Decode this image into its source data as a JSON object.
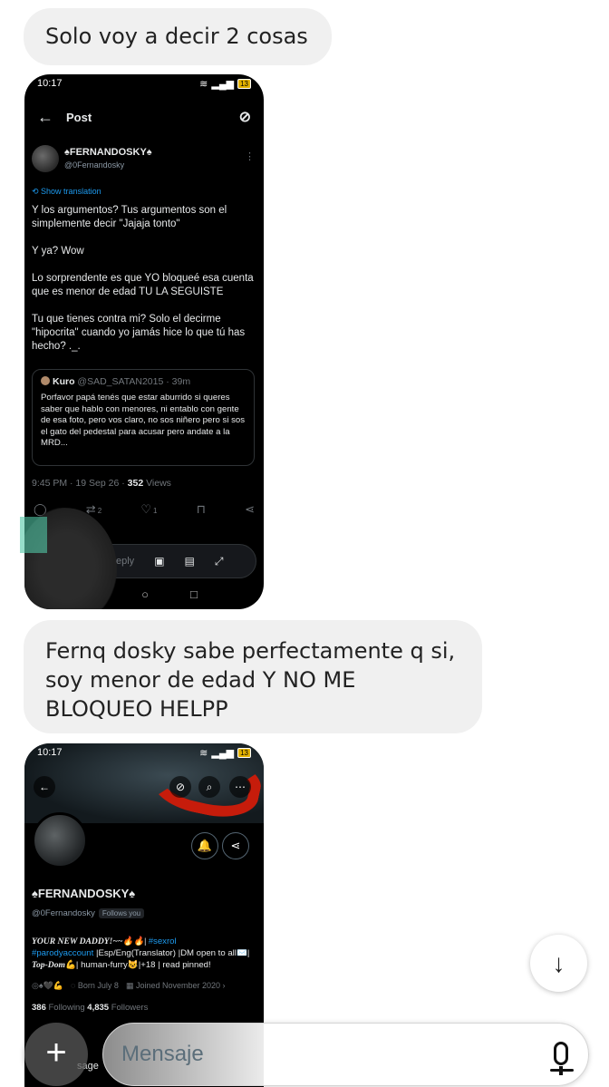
{
  "chat": {
    "message1": "Solo voy a decir 2 cosas",
    "message2": "Fernq dosky sabe perfectamente q si, soy menor de edad Y NO ME BLOQUEO HELPP",
    "input_placeholder": "Mensaje",
    "add_label": "+",
    "scroll_down_label": "↓"
  },
  "screenshot1": {
    "time": "10:17",
    "title": "Post",
    "author_name": "♠FERNANDOSKY♠",
    "author_handle": "@0Fernandosky",
    "translate_label": "Show translation",
    "tweet_text": "Y los argumentos? Tus argumentos son el simplemente decir \"Jajaja tonto\"\n\nY ya? Wow\n\nLo sorprendente es que YO bloqueé esa cuenta que es menor de edad TU LA SEGUISTE\n\nTu que tienes contra mi? Solo el decirme \"hipocrita\" cuando yo jamás hice lo que tú has hecho? ._.",
    "quote": {
      "name": "Kuro",
      "handle": "@SAD_SATAN2015 · 39m",
      "text": "Porfavor papá tenés que estar aburrido si queres saber que hablo con menores, ni entablo con gente de esa foto, pero vos claro, no sos niñero pero si sos el gato del pedestal para acusar pero andate a la MRD..."
    },
    "meta_time": "9:45 PM · 19 Sep 26 · ",
    "views_count": "352",
    "views_label": " Views",
    "retweets": "2",
    "likes": "1",
    "reply_placeholder": "eply"
  },
  "screenshot2": {
    "time": "10:17",
    "profile_name": "♠FERNANDOSKY♠",
    "profile_handle": "@0Fernandosky",
    "follows_you": "Follows you",
    "bio_line1_a": "YOUR NEW DADDY!~~🔥🔥| ",
    "bio_tag1": "#sexrol",
    "bio_tag2": "#parodyaccount",
    "bio_line2_b": " |Esp/Eng(Translator) |DM open to all✉️| ",
    "bio_topdom": "Top-Dom",
    "bio_line3": "💪| human-furry😺|+18 | read pinned!",
    "meta_icons": "◎♠🖤💪",
    "born": "Born July 8",
    "joined": "Joined November 2020",
    "following_count": "386",
    "following_label": " Following  ",
    "followers_count": "4,835",
    "followers_label": " Followers",
    "partial": "sage"
  }
}
